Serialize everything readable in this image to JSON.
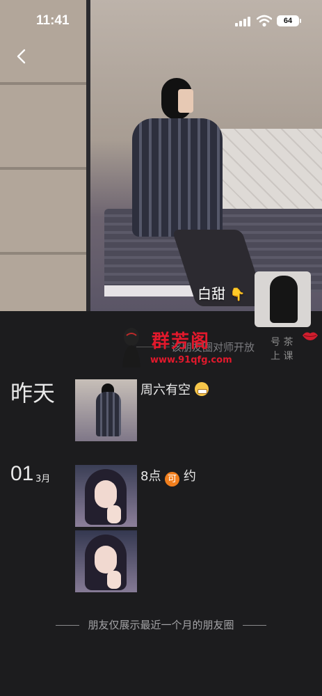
{
  "status_bar": {
    "time": "11:41",
    "battery": "64"
  },
  "profile": {
    "signature": "白甜",
    "signature_emoji": "👇",
    "visibility_notice": "该朋友圈对师开放"
  },
  "watermark": {
    "title": "群芳阁",
    "url": "www.91qfg.com",
    "side_line1": "号 茶",
    "side_line2": "上 课"
  },
  "feed": [
    {
      "day_label": "昨天",
      "text": "周六有空",
      "emoji": "grinning-face"
    },
    {
      "date_day": "01",
      "date_month": "3月",
      "text_before": "8点",
      "emoji_text": "可",
      "text_after": " 约"
    }
  ],
  "footer": {
    "note": "朋友仅展示最近一个月的朋友圈"
  },
  "colors": {
    "background": "#1c1c1e",
    "watermark_red": "#e2192c",
    "emoji_orange": "#f07e1d"
  }
}
